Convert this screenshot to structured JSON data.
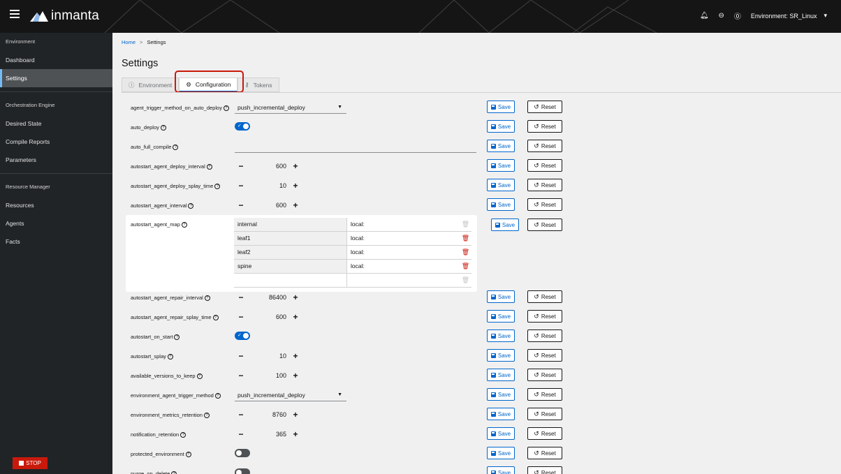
{
  "header": {
    "logo_text": "inmanta",
    "environment_label": "Environment: SR_Linux"
  },
  "sidebar": {
    "sections": [
      {
        "title": "Environment",
        "items": [
          "Dashboard",
          "Settings"
        ]
      },
      {
        "title": "Orchestration Engine",
        "items": [
          "Desired State",
          "Compile Reports",
          "Parameters"
        ]
      },
      {
        "title": "Resource Manager",
        "items": [
          "Resources",
          "Agents",
          "Facts"
        ]
      }
    ],
    "active_item": "Settings",
    "stop_label": "STOP"
  },
  "breadcrumb": {
    "home": "Home",
    "separator": ">",
    "current": "Settings"
  },
  "page_title": "Settings",
  "tabs": [
    {
      "label": "Environment",
      "icon": "info-circle-icon"
    },
    {
      "label": "Configuration",
      "icon": "cog-icon",
      "active": true
    },
    {
      "label": "Tokens",
      "icon": "key-icon"
    }
  ],
  "buttons": {
    "save": "Save",
    "reset": "Reset"
  },
  "settings": [
    {
      "name": "agent_trigger_method_on_auto_deploy",
      "kind": "select",
      "value": "push_incremental_deploy"
    },
    {
      "name": "auto_deploy",
      "kind": "toggle",
      "value": "on"
    },
    {
      "name": "auto_full_compile",
      "kind": "text",
      "value": ""
    },
    {
      "name": "autostart_agent_deploy_interval",
      "kind": "number",
      "value": "600"
    },
    {
      "name": "autostart_agent_deploy_splay_time",
      "kind": "number",
      "value": "10"
    },
    {
      "name": "autostart_agent_interval",
      "kind": "number",
      "value": "600"
    },
    {
      "name": "autostart_agent_map",
      "kind": "map"
    },
    {
      "name": "autostart_agent_repair_interval",
      "kind": "number",
      "value": "86400"
    },
    {
      "name": "autostart_agent_repair_splay_time",
      "kind": "number",
      "value": "600"
    },
    {
      "name": "autostart_on_start",
      "kind": "toggle",
      "value": "on"
    },
    {
      "name": "autostart_splay",
      "kind": "number",
      "value": "10"
    },
    {
      "name": "available_versions_to_keep",
      "kind": "number",
      "value": "100"
    },
    {
      "name": "environment_agent_trigger_method",
      "kind": "select",
      "value": "push_incremental_deploy"
    },
    {
      "name": "environment_metrics_retention",
      "kind": "number",
      "value": "8760"
    },
    {
      "name": "notification_retention",
      "kind": "number",
      "value": "365"
    },
    {
      "name": "protected_environment",
      "kind": "toggle",
      "value": "off"
    },
    {
      "name": "purge_on_delete",
      "kind": "toggle",
      "value": "off"
    }
  ],
  "agent_map": [
    {
      "key": "internal",
      "value": "local:"
    },
    {
      "key": "leaf1",
      "value": "local:"
    },
    {
      "key": "leaf2",
      "value": "local:"
    },
    {
      "key": "spine",
      "value": "local:"
    },
    {
      "key": "",
      "value": ""
    }
  ]
}
